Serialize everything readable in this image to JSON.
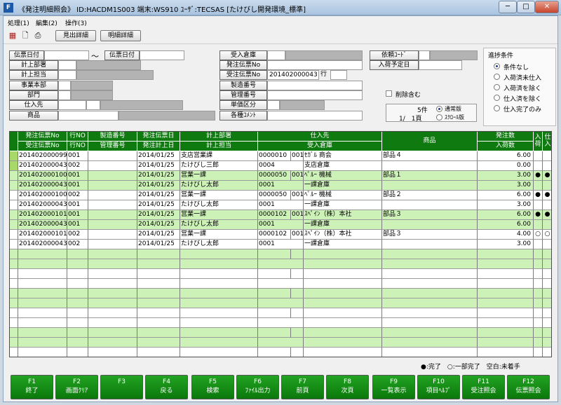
{
  "window": {
    "icon_text": "F",
    "title": "《発注明細照会》 ID:HACDM1S003 端末:WS910 ﾕｰｻﾞ:TECSAS [たけびし開発環境_標準]",
    "min": "─",
    "max": "□",
    "close": "✕"
  },
  "menu": [
    {
      "label": "処理(1)"
    },
    {
      "label": "編集(2)"
    },
    {
      "label": "操作(3)"
    }
  ],
  "toolbar": {
    "detail_header": "見出詳細",
    "detail_rows": "明細詳細"
  },
  "form": {
    "date_label_from": "伝票日付",
    "tilde": "〜",
    "date_label_to": "伝票日付",
    "dept_label": "計上部署",
    "staff_label": "計上担当",
    "division_label": "事業本部",
    "section_label": "部門",
    "supplier_label": "仕入先",
    "product_label": "商品",
    "warehouse_label": "受入倉庫",
    "po_label": "発注伝票No",
    "ro_label": "受注伝票No",
    "ro_value": "201402000043",
    "row_label": "行",
    "mfg_label": "製造番号",
    "mgmt_label": "管理番号",
    "unit_label": "単価区分",
    "comment_label": "各種ｺﾒﾝﾄ",
    "request_label": "依頼ｺｰﾄﾞ",
    "arrival_label": "入荷予定日",
    "delete_label": "削除含む",
    "count_value": "5件",
    "page_value": "1/　1頁",
    "normal_label": "通常版",
    "scroll_label": "ｽｸﾛｰﾙ版"
  },
  "progress": {
    "title": "進捗条件",
    "options": [
      {
        "label": "条件なし",
        "selected": true
      },
      {
        "label": "入荷済未仕入",
        "selected": false
      },
      {
        "label": "入荷済を除く",
        "selected": false
      },
      {
        "label": "仕入済を除く",
        "selected": false
      },
      {
        "label": "仕入完了のみ",
        "selected": false
      }
    ]
  },
  "grid": {
    "headers": {
      "po_no": "発注伝票No",
      "ro_no": "受注伝票No",
      "row_no_1": "行NO",
      "row_no_2": "行NO",
      "mfg": "製造番号",
      "mgmt": "管理番号",
      "order_date": "発注伝票日",
      "book_date": "発注計上日",
      "dept": "計上部署",
      "staff": "計上担当",
      "supplier": "仕入先",
      "warehouse": "受入倉庫",
      "product": "商品",
      "qty": "発注数",
      "arrived": "入荷数",
      "arrival_flag": "入荷",
      "purchase_flag": "仕入"
    },
    "records": [
      {
        "po": "201402000099",
        "po_row": "001",
        "mfg": "",
        "date": "2014/01/25",
        "dept": "支店営業課",
        "sup_code": "0000010",
        "sup_br": "001",
        "sup_name": "ｾｶﾞﾙ 商会",
        "product": "部品４",
        "qty": "6.00",
        "arr_flag": "",
        "pur_flag": "",
        "ro": "201402000043",
        "ro_row": "002",
        "mgmt": "",
        "book": "2014/01/25",
        "staff": "たけびし三郎",
        "wh_code": "0004",
        "wh_name": "支店倉庫",
        "arrived": "0.00"
      },
      {
        "po": "201402000100",
        "po_row": "001",
        "mfg": "",
        "date": "2014/01/25",
        "dept": "営業一課",
        "sup_code": "0000050",
        "sup_br": "001",
        "sup_name": "ﾍﾟﾙｰ 機械",
        "product": "部品１",
        "qty": "3.00",
        "arr_flag": "●",
        "pur_flag": "●",
        "ro": "201402000043",
        "ro_row": "001",
        "mgmt": "",
        "book": "2014/01/25",
        "staff": "たけびし太郎",
        "wh_code": "0001",
        "wh_name": "一課倉庫",
        "arrived": "3.00"
      },
      {
        "po": "201402000100",
        "po_row": "002",
        "mfg": "",
        "date": "2014/01/25",
        "dept": "営業一課",
        "sup_code": "0000050",
        "sup_br": "001",
        "sup_name": "ﾍﾟﾙｰ 機械",
        "product": "部品２",
        "qty": "6.00",
        "arr_flag": "●",
        "pur_flag": "●",
        "ro": "201402000043",
        "ro_row": "001",
        "mgmt": "",
        "book": "2014/01/25",
        "staff": "たけびし太郎",
        "wh_code": "0001",
        "wh_name": "一課倉庫",
        "arrived": "3.00"
      },
      {
        "po": "201402000101",
        "po_row": "001",
        "mfg": "",
        "date": "2014/01/25",
        "dept": "営業一課",
        "sup_code": "0000102",
        "sup_br": "001",
        "sup_name": "ｽﾍﾟｲﾝ（株）本社",
        "product": "部品３",
        "qty": "6.00",
        "arr_flag": "●",
        "pur_flag": "●",
        "ro": "201402000043",
        "ro_row": "001",
        "mgmt": "",
        "book": "2014/01/25",
        "staff": "たけびし太郎",
        "wh_code": "0001",
        "wh_name": "一課倉庫",
        "arrived": "6.00"
      },
      {
        "po": "201402000101",
        "po_row": "002",
        "mfg": "",
        "date": "2014/01/25",
        "dept": "営業一課",
        "sup_code": "0000102",
        "sup_br": "001",
        "sup_name": "ｽﾍﾟｲﾝ（株）本社",
        "product": "部品３",
        "qty": "4.00",
        "arr_flag": "○",
        "pur_flag": "○",
        "ro": "201402000043",
        "ro_row": "002",
        "mgmt": "",
        "book": "2014/01/25",
        "staff": "たけびし太郎",
        "wh_code": "0001",
        "wh_name": "一課倉庫",
        "arrived": "3.00"
      }
    ]
  },
  "legend": "●:完了　○:一部完了　空白:未着手",
  "fkeys": [
    {
      "key": "F1",
      "label": "終了"
    },
    {
      "key": "F2",
      "label": "画面ｸﾘｱ"
    },
    {
      "key": "F3",
      "label": ""
    },
    {
      "key": "F4",
      "label": "戻る"
    },
    {
      "key": "F5",
      "label": "検索"
    },
    {
      "key": "F6",
      "label": "ﾌｧｲﾙ出力"
    },
    {
      "key": "F7",
      "label": "前頁"
    },
    {
      "key": "F8",
      "label": "次頁"
    },
    {
      "key": "F9",
      "label": "一覧表示"
    },
    {
      "key": "F10",
      "label": "項目ﾍﾙﾌﾟ"
    },
    {
      "key": "F11",
      "label": "受注照会"
    },
    {
      "key": "F12",
      "label": "伝票照会"
    }
  ],
  "colors": {
    "header_green": "#0f7a10",
    "row_green": "#cdf2b8",
    "row_white": "#ffffff",
    "fkey_green": "#119211",
    "selected_marker": "#a8d86a"
  }
}
